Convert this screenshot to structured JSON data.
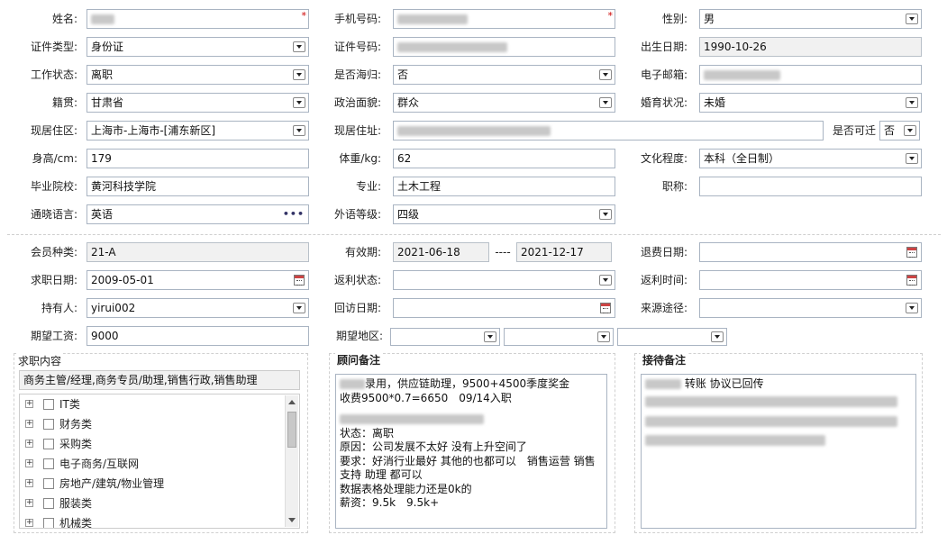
{
  "basic": {
    "name_label": "姓名:",
    "phone_label": "手机号码:",
    "gender_label": "性别:",
    "gender_value": "男",
    "id_type_label": "证件类型:",
    "id_type_value": "身份证",
    "id_no_label": "证件号码:",
    "birth_label": "出生日期:",
    "birth_value": "1990-10-26",
    "work_status_label": "工作状态:",
    "work_status_value": "离职",
    "returnee_label": "是否海归:",
    "returnee_value": "否",
    "email_label": "电子邮箱:",
    "native_label": "籍贯:",
    "native_value": "甘肃省",
    "politics_label": "政治面貌:",
    "politics_value": "群众",
    "marital_label": "婚育状况:",
    "marital_value": "未婚",
    "residence_area_label": "现居住区:",
    "residence_area_value": "上海市-上海市-[浦东新区]",
    "address_label": "现居住址:",
    "relocate_label": "是否可迁",
    "relocate_value": "否",
    "height_label": "身高/cm:",
    "height_value": "179",
    "weight_label": "体重/kg:",
    "weight_value": "62",
    "education_label": "文化程度:",
    "education_value": "本科（全日制）",
    "school_label": "毕业院校:",
    "school_value": "黄河科技学院",
    "major_label": "专业:",
    "major_value": "土木工程",
    "title_label": "职称:",
    "title_value": "",
    "language_label": "通晓语言:",
    "language_value": "英语",
    "lang_level_label": "外语等级:",
    "lang_level_value": "四级"
  },
  "membership": {
    "member_type_label": "会员种类:",
    "member_type_value": "21-A",
    "valid_label": "有效期:",
    "valid_from": "2021-06-18",
    "valid_sep": "----",
    "valid_to": "2021-12-17",
    "refund_date_label": "退费日期:",
    "job_date_label": "求职日期:",
    "job_date_value": "2009-05-01",
    "rebate_status_label": "返利状态:",
    "rebate_time_label": "返利时间:",
    "holder_label": "持有人:",
    "holder_value": "yirui002",
    "visit_date_label": "回访日期:",
    "source_label": "来源途径:",
    "salary_label": "期望工资:",
    "salary_value": "9000",
    "area_label": "期望地区:"
  },
  "job_content": {
    "title": "求职内容",
    "selected": "商务主管/经理,商务专员/助理,销售行政,销售助理",
    "tree": [
      "IT类",
      "财务类",
      "采购类",
      "电子商务/互联网",
      "房地产/建筑/物业管理",
      "服装类",
      "机械类"
    ]
  },
  "advisor_note": {
    "title": "顾问备注",
    "line1_suffix": "录用，供应链助理，9500+4500季度奖金",
    "line2": "收费9500*0.7=6650　09/14入职",
    "status": "状态：离职",
    "reason": "原因：公司发展不太好 没有上升空间了",
    "require1": "要求：好消行业最好 其他的也都可以　销售运营 销售",
    "require2": "支持 助理 都可以",
    "data_skill": "数据表格处理能力还是0k的",
    "salary": "薪资：9.5k　9.5k+"
  },
  "reception_note": {
    "title": "接待备注",
    "line1": "转账 协议已回传"
  }
}
